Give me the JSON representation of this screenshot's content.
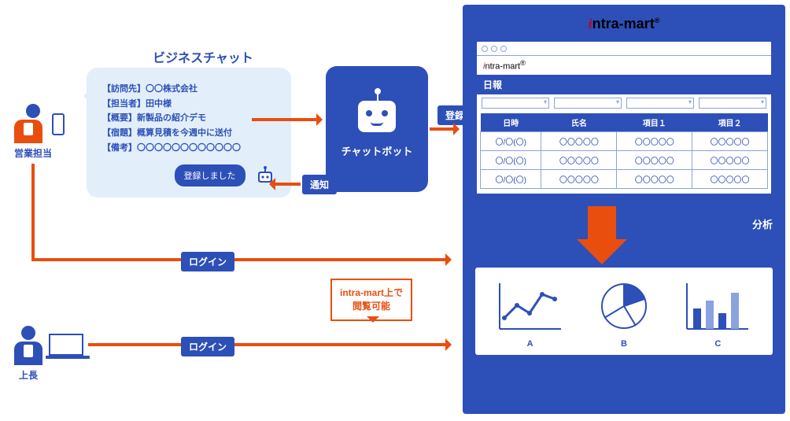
{
  "roles": {
    "sales": "営業担当",
    "boss": "上長"
  },
  "chat": {
    "title": "ビジネスチャット",
    "fields": {
      "visit": "【訪問先】〇〇株式会社",
      "contact": "【担当者】田中様",
      "summary": "【概要】新製品の紹介デモ",
      "homework": "【宿題】概算見積を今週中に送付",
      "note": "【備考】〇〇〇〇〇〇〇〇〇〇〇〇"
    },
    "confirm": "登録しました"
  },
  "chatbot": {
    "label": "チャットボット"
  },
  "flow": {
    "notify": "通知",
    "register": "登録",
    "login": "ログイン"
  },
  "viewable": {
    "line1": "intra-mart上で",
    "line2": "閲覧可能"
  },
  "intramart": {
    "brand_i": "i",
    "brand_rest": "ntra-mart",
    "reg": "®",
    "report_title": "日報",
    "columns": [
      "日時",
      "氏名",
      "項目１",
      "項目２"
    ],
    "rows": [
      [
        "〇/〇(〇)",
        "〇〇〇〇〇",
        "〇〇〇〇〇",
        "〇〇〇〇〇"
      ],
      [
        "〇/〇(〇)",
        "〇〇〇〇〇",
        "〇〇〇〇〇",
        "〇〇〇〇〇"
      ],
      [
        "〇/〇(〇)",
        "〇〇〇〇〇",
        "〇〇〇〇〇",
        "〇〇〇〇〇"
      ]
    ],
    "analysis": "分析",
    "charts": [
      "A",
      "B",
      "C"
    ]
  }
}
